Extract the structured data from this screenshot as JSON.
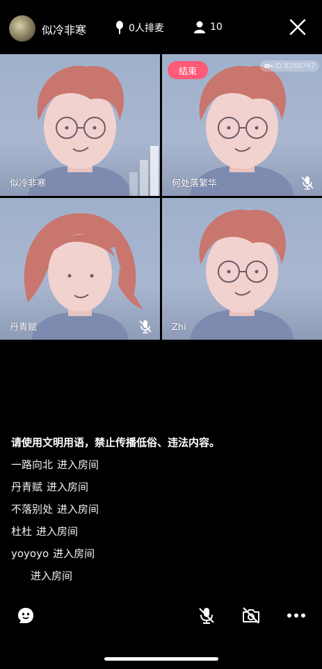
{
  "header": {
    "host_name": "似冷非寒",
    "mic_queue": "0人排麦",
    "viewer_count": "10"
  },
  "tiles": [
    {
      "name": "似冷非寒",
      "muted": false
    },
    {
      "name": "何处落繁华",
      "muted": true,
      "end_label": "结束",
      "room_id": "ID 8250747"
    },
    {
      "name": "丹青赋",
      "muted": true
    },
    {
      "name": "Zhi",
      "muted": false
    }
  ],
  "chat": {
    "notice": "请使用文明用语，禁止传播低俗、违法内容。",
    "messages": [
      {
        "user": "一路向北",
        "action": "进入房间"
      },
      {
        "user": "丹青赋",
        "action": "进入房间"
      },
      {
        "user": "不落别处",
        "action": "进入房间"
      },
      {
        "user": "杜杜",
        "action": "进入房间"
      },
      {
        "user": "yoyoyo",
        "action": "进入房间"
      },
      {
        "user": "",
        "action": "进入房间"
      }
    ]
  },
  "icons": {
    "mic_queue": "microphone-icon",
    "viewers": "person-icon",
    "close": "close-icon",
    "emoji": "emoji-icon",
    "mute": "mic-off-icon",
    "camera_off": "camera-off-icon",
    "more": "more-icon"
  },
  "colors": {
    "end_badge": "#ff5a78",
    "tile_bg": "#a9b7d0",
    "hair": "#c9766f"
  }
}
